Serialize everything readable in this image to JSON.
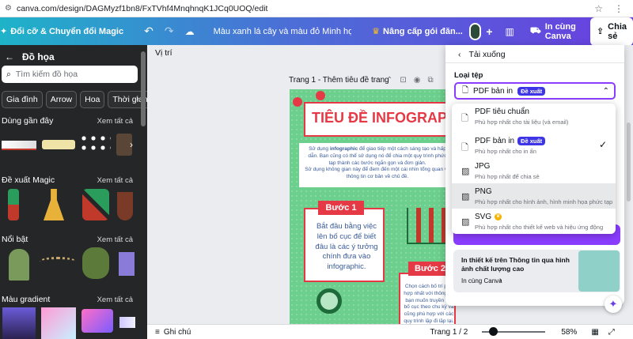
{
  "browser": {
    "url": "canva.com/design/DAGMyzf1bn8/FxTVhf4MnqhnqK1JCq0UOQ/edit"
  },
  "topbar": {
    "magic_switch": "Đổi cỡ & Chuyển đổi Magic",
    "doc_title": "Màu xanh lá cây và màu đỏ Minh họa Infographic quy ...",
    "upgrade": "Nâng cấp gói đăn...",
    "add": "+",
    "present_canva": "In cùng Canva",
    "share": "Chia sẻ"
  },
  "sidebar": {
    "title": "Đồ họa",
    "search_placeholder": "Tìm kiếm đồ họa",
    "chips": [
      "Gia đình",
      "Arrow",
      "Hoa",
      "Thời gian"
    ],
    "sections": [
      {
        "title": "Dùng gần đây",
        "see_all": "Xem tất cả"
      },
      {
        "title": "Đề xuất Magic",
        "see_all": "Xem tất cả"
      },
      {
        "title": "Nổi bật",
        "see_all": "Xem tất cả"
      },
      {
        "title": "Màu gradient",
        "see_all": "Xem tất cả"
      }
    ]
  },
  "canvas": {
    "position_label": "Vị trí",
    "page_label": "Trang 1 - Thêm tiêu đề trang",
    "infographic": {
      "title": "TIÊU ĐỀ INFOGRAPHIC",
      "intro1_pre": "Sử dụng ",
      "intro1_bold": "infographic",
      "intro1_post": " để giao tiếp một cách sáng tạo và hấp dẫn. Bạn cũng có thể sử dụng nó để chia một quy trình phức tạp thành các bước ngắn gọn và đơn giản.",
      "intro2": "Sử dụng không gian này để đem đến một cái nhìn tổng quan về thông tin cơ bản về chủ đề.",
      "step1": "Bước 1",
      "step1_text": "Bắt đầu bằng việc lên bố cục để biết đâu là các ý tưởng chính đưa vào infographic.",
      "step2": "Bước 2",
      "step2_text": "Chọn cách bố trí phù hợp nhất với thông tin bạn muốn truyền tải, bố cục theo chu kỳ và cũng phù hợp với các quy trình lặp đi lặp lại. Bố cục"
    }
  },
  "bottombar": {
    "notes": "Ghi chú",
    "page_counter": "Trang 1 / 2",
    "zoom": "58%",
    "zoom_level": 0.58
  },
  "download_panel": {
    "title": "Tải xuống",
    "file_type_label": "Loại tệp",
    "selected": "PDF bản in",
    "selected_badge": "Đề xuất",
    "options": [
      {
        "name": "PDF tiêu chuẩn",
        "desc": "Phù hợp nhất cho tài liệu (và email)",
        "icon": "document-icon",
        "badge": "",
        "checked": false
      },
      {
        "name": "PDF bản in",
        "desc": "Phù hợp nhất cho in ấn",
        "icon": "document-icon",
        "badge": "Đề xuất",
        "checked": true
      },
      {
        "name": "JPG",
        "desc": "Phù hợp nhất để chia sẻ",
        "icon": "image-icon",
        "badge": "",
        "checked": false
      },
      {
        "name": "PNG",
        "desc": "Phù hợp nhất cho hình ảnh, hình minh họa phức tạp",
        "icon": "image-icon",
        "badge": "",
        "checked": false
      },
      {
        "name": "SVG",
        "desc": "Phù hợp nhất cho thiết kế web và hiệu ứng động",
        "icon": "image-icon",
        "badge": "",
        "checked": false
      }
    ],
    "promo_text": "In thiết kế trên Thông tin qua hình ảnh chất lượng cao",
    "promo_link": "In cùng Canva"
  },
  "colors": {
    "brand_purple": "#8b3dff",
    "badge_blue": "#3e35e6",
    "infographic_green": "#6ccf8d",
    "infographic_red": "#e63946"
  }
}
